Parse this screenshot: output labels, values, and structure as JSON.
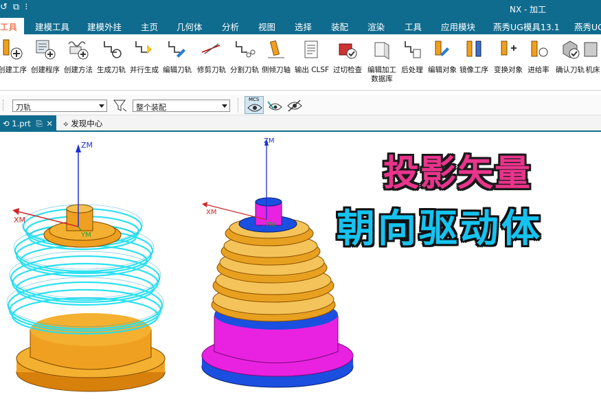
{
  "titlebar": {
    "title": "NX - 加工"
  },
  "menu": {
    "tabs": [
      {
        "label": "工具",
        "active": true
      },
      {
        "label": "建模工具"
      },
      {
        "label": "建模外挂"
      },
      {
        "label": "主页"
      },
      {
        "label": "几何体"
      },
      {
        "label": "分析"
      },
      {
        "label": "视图"
      },
      {
        "label": "选择"
      },
      {
        "label": "装配"
      },
      {
        "label": "渲染"
      },
      {
        "label": "工具"
      },
      {
        "label": "应用模块"
      },
      {
        "label": "燕秀UG模具13.1"
      },
      {
        "label": "燕秀UG"
      }
    ]
  },
  "ribbon": {
    "buttons": [
      {
        "label": "创建工序",
        "icon": "create-operation-icon"
      },
      {
        "label": "创建程序",
        "icon": "create-program-icon"
      },
      {
        "label": "创建方法",
        "icon": "create-method-icon"
      },
      {
        "label": "生成刀轨",
        "icon": "generate-toolpath-icon"
      },
      {
        "label": "并行生成",
        "icon": "parallel-generate-icon"
      },
      {
        "label": "编辑刀轨",
        "icon": "edit-toolpath-icon"
      },
      {
        "label": "修剪刀轨",
        "icon": "trim-toolpath-icon"
      },
      {
        "label": "分割刀轨",
        "icon": "split-toolpath-icon"
      },
      {
        "label": "侧倾刀轴",
        "icon": "tilt-tool-axis-icon"
      },
      {
        "label": "输出 CLSF",
        "icon": "output-clsf-icon"
      },
      {
        "label": "过切检查",
        "icon": "gouge-check-icon"
      },
      {
        "label": "编辑加工\n数据库",
        "icon": "edit-database-icon"
      },
      {
        "label": "后处理",
        "icon": "postprocess-icon"
      },
      {
        "label": "编辑对象",
        "icon": "edit-object-icon"
      },
      {
        "label": "镜像工序",
        "icon": "mirror-operation-icon"
      },
      {
        "label": "变换对象",
        "icon": "transform-object-icon"
      },
      {
        "label": "进给率",
        "icon": "feedrate-icon"
      },
      {
        "label": "确认刀轨",
        "icon": "verify-toolpath-icon"
      },
      {
        "label": "机床",
        "icon": "machine-icon"
      }
    ]
  },
  "toolbar2": {
    "filter_value": "刀轨",
    "assembly_value": "整个装配",
    "mcs_label": "MCS"
  },
  "tabs": {
    "doc_tab": "1.prt",
    "discover": "发现中心"
  },
  "viewport": {
    "axis_labels": {
      "zm": "ZM",
      "xm": "XM",
      "ym": "YM"
    },
    "banner_line1": "投影矢量",
    "banner_line2": "朝向驱动体"
  },
  "colors": {
    "brand": "#0f6c8f",
    "active_tab_text": "#e8501c",
    "banner_pink": "#e9348c",
    "banner_cyan": "#15c3f0",
    "part_orange": "#f0a020",
    "part_magenta": "#e822e0",
    "part_blue": "#1a4fe0",
    "toolpath_cyan": "#22e0f0"
  }
}
